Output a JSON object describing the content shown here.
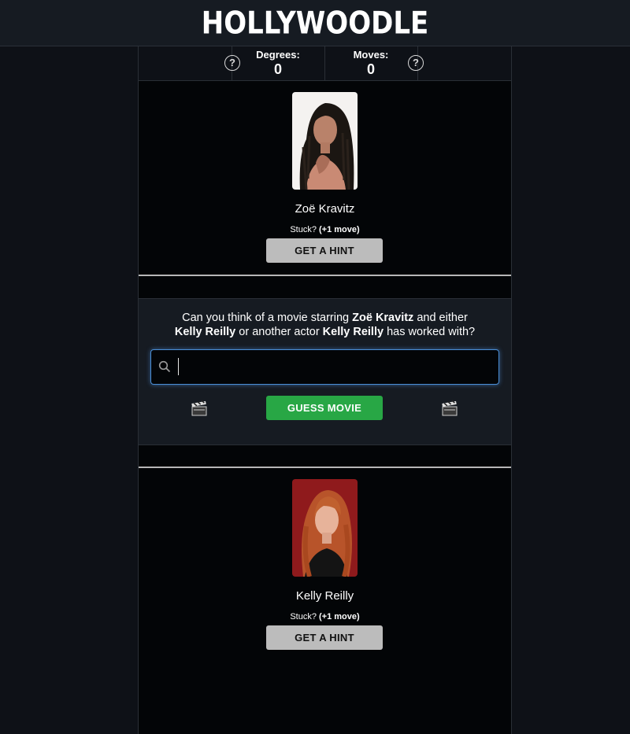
{
  "header": {
    "logo": "HOLLYWOODLE"
  },
  "stats": {
    "degrees_label": "Degrees:",
    "degrees_value": "0",
    "moves_label": "Moves:",
    "moves_value": "0",
    "help_glyph": "?"
  },
  "start_actor": {
    "name": "Zoë Kravitz",
    "stuck_text": "Stuck?",
    "stuck_cost": "(+1 move)",
    "hint_label": "GET A HINT"
  },
  "guess": {
    "q_part1": "Can you think of a movie starring ",
    "q_actor1": "Zoë Kravitz",
    "q_part2": " and either ",
    "q_actor2": "Kelly Reilly",
    "q_part3": " or another actor ",
    "q_actor3": "Kelly Reilly",
    "q_part4": " has worked with?",
    "search_value": "",
    "search_placeholder": "",
    "button_label": "GUESS MOVIE",
    "left_icon": "clapperboard-icon",
    "right_icon": "clapperboard-icon"
  },
  "end_actor": {
    "name": "Kelly Reilly",
    "stuck_text": "Stuck?",
    "stuck_cost": "(+1 move)",
    "hint_label": "GET A HINT"
  },
  "colors": {
    "background": "#0e1117",
    "column": "#030507",
    "guess_button": "#28a745",
    "hint_button": "#bcbcbc",
    "search_focus": "#4a8ed6"
  }
}
